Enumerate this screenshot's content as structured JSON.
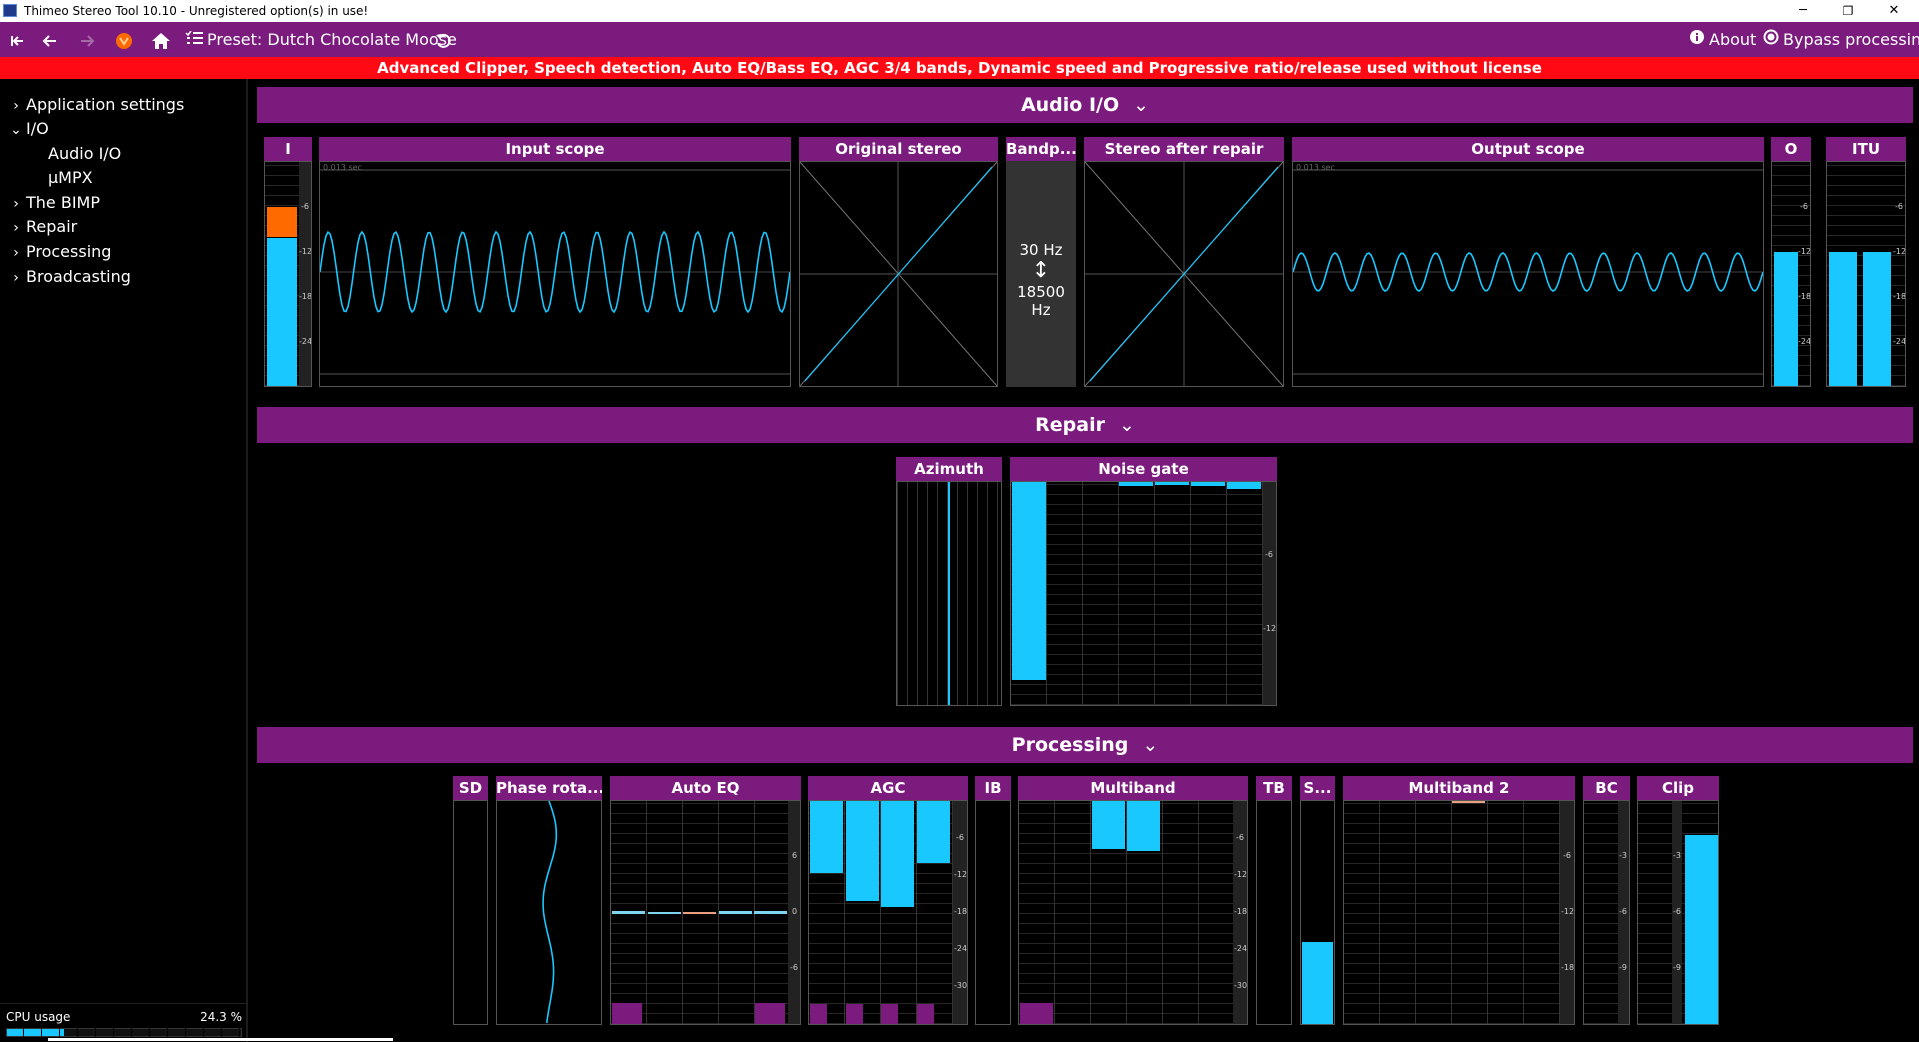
{
  "window": {
    "title": "Thimeo Stereo Tool 10.10 - Unregistered option(s) in use!",
    "minimize": "─",
    "restore": "❐",
    "close": "✕"
  },
  "toolbar": {
    "preset_label": "Preset: Dutch Chocolate Moose",
    "about_label": "About",
    "bypass_label": "Bypass processing"
  },
  "license_banner": "Advanced Clipper, Speech detection, Auto EQ/Bass EQ, AGC 3/4 bands, Dynamic speed and Progressive ratio/release used without license",
  "sidebar": {
    "items": [
      {
        "label": "Application settings",
        "chevron": "›"
      },
      {
        "label": "I/O",
        "chevron": "⌄"
      },
      {
        "label": "Audio I/O",
        "chevron": ""
      },
      {
        "label": "µMPX",
        "chevron": ""
      },
      {
        "label": "The BIMP",
        "chevron": "›"
      },
      {
        "label": "Repair",
        "chevron": "›"
      },
      {
        "label": "Processing",
        "chevron": "›"
      },
      {
        "label": "Broadcasting",
        "chevron": "›"
      }
    ],
    "cpu_label": "CPU usage",
    "cpu_value": "24.3 %",
    "cpu_fraction": 0.243
  },
  "sections": {
    "audio_io": "Audio I/O",
    "repair": "Repair",
    "processing": "Processing",
    "chevron": "⌄"
  },
  "audio_io": {
    "input_meter": "I",
    "input_scope": "Input scope",
    "original_stereo": "Original stereo",
    "bandpass": "Bandp...",
    "stereo_after_repair": "Stereo after repair",
    "output_scope": "Output scope",
    "output_meter": "O",
    "itu": "ITU",
    "bandpass_low": "30 Hz",
    "bandpass_high": "18500 Hz",
    "bandpass_arrow": "↕",
    "scope_time": "0.013 sec",
    "meter_scale": [
      "-6",
      "-12",
      "-18",
      "-24"
    ]
  },
  "repair": {
    "azimuth": "Azimuth",
    "noise_gate": "Noise gate",
    "scale": [
      "-6",
      "-12"
    ]
  },
  "processing": {
    "sd": "SD",
    "phase_rotator": "Phase rota...",
    "auto_eq": "Auto EQ",
    "agc": "AGC",
    "ib": "IB",
    "multiband": "Multiband",
    "tb": "TB",
    "s": "S...",
    "multiband2": "Multiband 2",
    "bc": "BC",
    "clip": "Clip",
    "auto_eq_scale": [
      "6",
      "0",
      "-6"
    ],
    "agc_scale": [
      "-6",
      "-12",
      "-18",
      "-24",
      "-30"
    ],
    "multiband_scale": [
      "-6",
      "-12",
      "-18",
      "-24",
      "-30"
    ],
    "multiband2_scale": [
      "-6",
      "-12",
      "-18"
    ],
    "bc_scale": [
      "-3",
      "-6",
      "-9"
    ],
    "clip_scale": [
      "-3",
      "-6",
      "-9"
    ]
  },
  "colors": {
    "accent": "#7b1b7e",
    "cyan": "#19c8ff",
    "orange": "#ff6a00",
    "red_banner": "#ff0a14"
  }
}
